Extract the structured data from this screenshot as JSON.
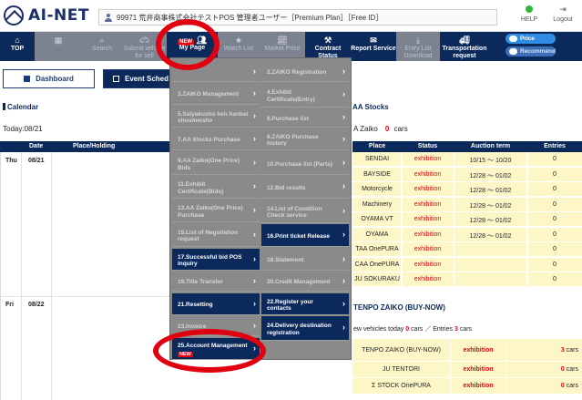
{
  "header": {
    "logo_text": "AI-NET",
    "user_text": "99971 荒井商事株式会社テストPOS 管理者ユーザー［Premium Plan］［Free ID］",
    "help_label": "HELP",
    "logout_label": "Logout"
  },
  "nav": {
    "top": "TOP",
    "my_page": "My Page",
    "my_page_badge": "NEW",
    "search": "Search",
    "submit_vehicle": "Submit vehicle for sell",
    "watch_list": "Watch List",
    "market_price": "Market Price",
    "contract_status": "Contract Status",
    "report_service": "Report Service",
    "entry_list_download": "Entry List Download",
    "transportation_request": "Transportation request",
    "toggle_price": "Price",
    "toggle_recommend": "Recommend"
  },
  "buttons": {
    "dashboard": "Dashboard",
    "event_schedule": "Event Sched"
  },
  "calendar": {
    "title": "Calendar",
    "today": "Today:08/21",
    "headers": [
      "Date",
      "Place/Holding"
    ],
    "rows": [
      {
        "dow": "Thu",
        "date": "08/21"
      },
      {
        "dow": "Fri",
        "date": "08/22"
      }
    ]
  },
  "menu": {
    "left": [
      {
        "label": "",
        "state": "dim"
      },
      {
        "label": "3.ZAIKO Management",
        "state": "dim"
      },
      {
        "label": "5.Saiyakusho ken hanbai shoumeisho",
        "state": "dim"
      },
      {
        "label": "7.AA Stocks Purchase",
        "state": "dim"
      },
      {
        "label": "9.AA Zaiko(One Price) Bids",
        "state": "dim"
      },
      {
        "label": "11.Exhibit Certificate(Bids)",
        "state": "dim"
      },
      {
        "label": "13.AA Zaiko(One Price) Purchase",
        "state": "dim"
      },
      {
        "label": "15.List of Negotiation request",
        "state": "dim"
      },
      {
        "label": "17.Successful bid POS inquiry",
        "state": "hl"
      },
      {
        "label": "19.Title Transfer",
        "state": "dim"
      },
      {
        "label": "21.Resetting",
        "state": "hl"
      },
      {
        "label": "23.Invoice",
        "state": "dim"
      },
      {
        "label": "25.Account Management",
        "state": "hl",
        "badge": "NEW"
      }
    ],
    "right": [
      {
        "label": "2.ZAIKO Registration",
        "state": "dim"
      },
      {
        "label": "4.Exhibit Certificate(Entry)",
        "state": "dim"
      },
      {
        "label": "6.Purchase list",
        "state": "dim"
      },
      {
        "label": "8.ZAIKO Purchase history",
        "state": "dim"
      },
      {
        "label": "10.Purchase list (Parts)",
        "state": "dim"
      },
      {
        "label": "12.Bid results",
        "state": "dim"
      },
      {
        "label": "14.List of Condition Check service",
        "state": "dim"
      },
      {
        "label": "16.Print ticket Release",
        "state": "hl"
      },
      {
        "label": "18.Statement",
        "state": "dim"
      },
      {
        "label": "20.Credit Management",
        "state": "dim"
      },
      {
        "label": "22.Register your contacts",
        "state": "hl"
      },
      {
        "label": "24.Delivery destination registration",
        "state": "hl"
      }
    ]
  },
  "aa_stocks": {
    "title": "AA Stocks",
    "zaiko_label": "A Zaiko",
    "zaiko_count": "0",
    "zaiko_unit": "cars",
    "headers": [
      "Place",
      "Status",
      "Auction term",
      "Entries"
    ],
    "rows": [
      {
        "place": "SENDAI",
        "status": "exhibition",
        "term": "10/15 ～ 10/20",
        "entries": "0"
      },
      {
        "place": "BAYSIDE",
        "status": "exhibition",
        "term": "12/28 ～ 01/02",
        "entries": "0"
      },
      {
        "place": "Motorcycle",
        "status": "exhibition",
        "term": "12/28 ～ 01/02",
        "entries": "0"
      },
      {
        "place": "Machinery",
        "status": "exhibition",
        "term": "12/28 ～ 01/02",
        "entries": "0"
      },
      {
        "place": "OYAMA VT",
        "status": "exhibition",
        "term": "12/28 ～ 01/02",
        "entries": "0"
      },
      {
        "place": "OYAMA",
        "status": "exhibition",
        "term": "12/28 ～ 01/02",
        "entries": "0"
      },
      {
        "place": "TAA OnePURA",
        "status": "exhibition",
        "term": "",
        "entries": "0"
      },
      {
        "place": "CAA OnePURA",
        "status": "exhibition",
        "term": "",
        "entries": "0"
      },
      {
        "place": "JU SOKURAKU",
        "status": "exhibition",
        "term": "",
        "entries": "0"
      }
    ]
  },
  "tenpo": {
    "title": "TENPO ZAIKO (BUY-NOW)",
    "line_prefix": "ew vehicles today",
    "today_count": "0",
    "cars1": "cars",
    "sep": "／",
    "entries_label": "Entries",
    "entries_count": "3",
    "cars2": "cars",
    "rows": [
      {
        "name": "TENPO ZAIKO (BUY-NOW)",
        "status": "exhibition",
        "count": "3",
        "unit": "cars"
      },
      {
        "name": "JU TENTORI",
        "status": "exhibition",
        "count": "0",
        "unit": "cars"
      },
      {
        "name": "Σ STOCK OnePURA",
        "status": "exhibition",
        "count": "0",
        "unit": "cars"
      }
    ]
  },
  "colors": {
    "navy": "#0b2a5b",
    "highlight_red": "#e10010",
    "status_red": "#e60012",
    "cell_yellow": "#fdf7c8"
  }
}
